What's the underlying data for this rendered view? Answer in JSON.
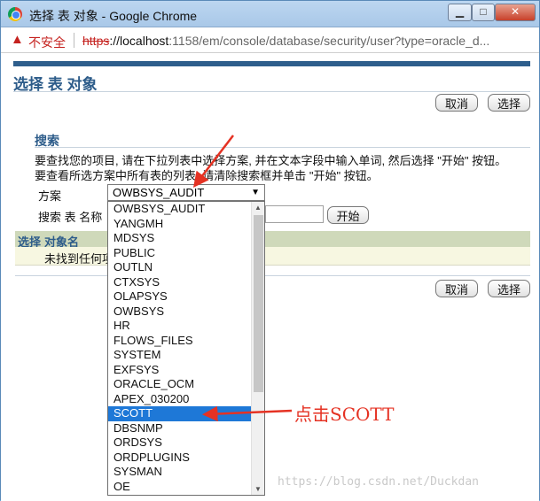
{
  "window": {
    "title": "选择 表 对象 - Google Chrome",
    "buttons": {
      "minimize": "▁",
      "maximize": "□",
      "close": "✕"
    }
  },
  "address": {
    "insecure_label": "不安全",
    "scheme": "https",
    "host": "://localhost",
    "path": ":1158/em/console/database/security/user?type=oracle_d..."
  },
  "page": {
    "title": "选择 表 对象",
    "cancel_label": "取消",
    "select_label": "选择"
  },
  "search": {
    "title": "搜索",
    "instruction_1": "要查找您的项目, 请在下拉列表中选择方案, 并在文本字段中输入单词, 然后选择 \"开始\" 按钮。",
    "instruction_2": "要查看所选方案中所有表的列表, 请清除搜索框并单击 \"开始\" 按钮。",
    "schema_label": "方案",
    "schema_value": "OWBSYS_AUDIT",
    "name_label": "搜索 表 名称",
    "name_value": "",
    "go_label": "开始"
  },
  "table": {
    "columns": [
      "选择",
      "对象名"
    ],
    "empty_text": "未找到任何项"
  },
  "dropdown": {
    "options": [
      "OWBSYS_AUDIT",
      "YANGMH",
      "MDSYS",
      "PUBLIC",
      "OUTLN",
      "CTXSYS",
      "OLAPSYS",
      "OWBSYS",
      "HR",
      "FLOWS_FILES",
      "SYSTEM",
      "EXFSYS",
      "ORACLE_OCM",
      "APEX_030200",
      "SCOTT",
      "DBSNMP",
      "ORDSYS",
      "ORDPLUGINS",
      "SYSMAN",
      "OE"
    ],
    "selected": "SCOTT"
  },
  "annotation": {
    "text": "点击SCOTT",
    "color": "#e53223"
  },
  "watermark": "https://blog.csdn.net/Duckdan",
  "colors": {
    "heading": "#2d5c8a",
    "band": "#2e5e8c",
    "highlight": "#1e78d7"
  },
  "icons": [
    "chrome-icon",
    "warning-icon",
    "chevron-down-icon"
  ]
}
